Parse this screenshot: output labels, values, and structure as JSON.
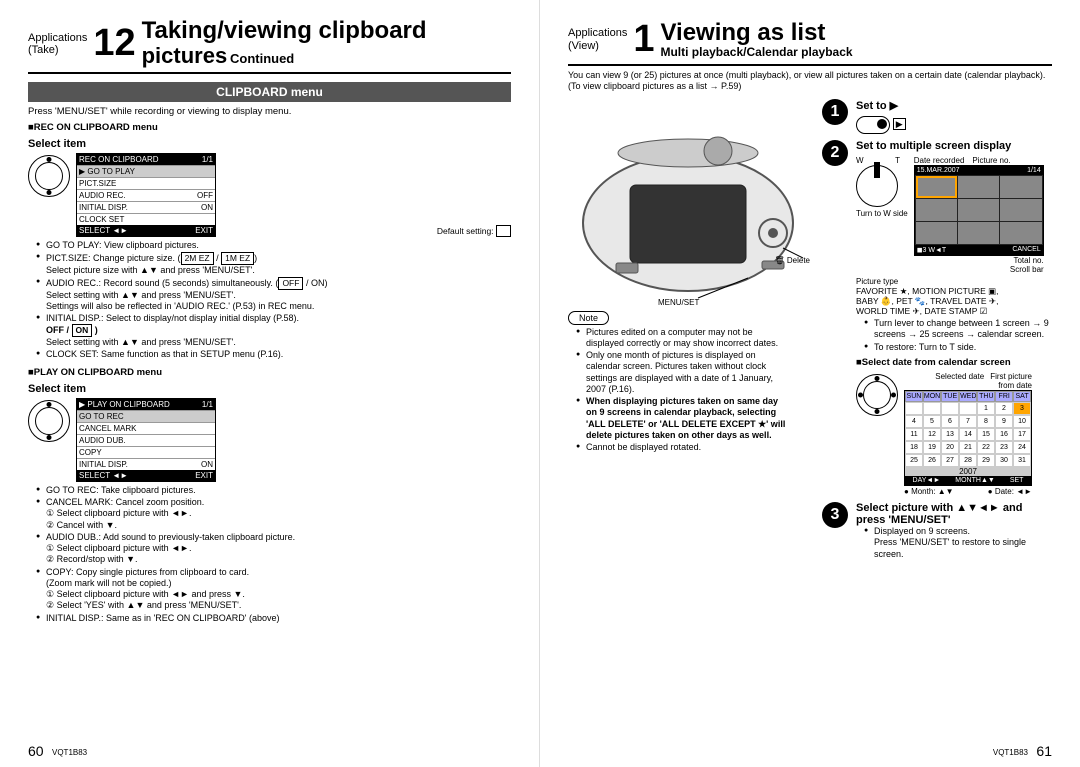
{
  "left": {
    "app_label": "Applications\n(Take)",
    "number": "12",
    "title_main": "Taking/viewing clipboard",
    "title_sub": "pictures",
    "title_cont": "Continued",
    "section_bar": "CLIPBOARD menu",
    "intro": "Press 'MENU/SET' while recording or viewing to display menu.",
    "rec_heading": "■REC ON CLIPBOARD menu",
    "select_item": "Select item",
    "rec_menu": {
      "title": "REC ON CLIPBOARD",
      "rows": [
        {
          "label": "▶ GO TO PLAY",
          "val": ""
        },
        {
          "label": "PICT.SIZE",
          "val": ""
        },
        {
          "label": "AUDIO REC.",
          "val": "OFF"
        },
        {
          "label": "INITIAL DISP.",
          "val": "ON"
        },
        {
          "label": "CLOCK SET",
          "val": ""
        }
      ],
      "foot_l": "SELECT ◄►",
      "foot_r": "EXIT"
    },
    "default_setting": "Default setting:",
    "rec_bullets": [
      "GO TO PLAY: View clipboard pictures.",
      "PICT.SIZE: Change picture size. (<span class='boxed'>2M EZ</span> / <span class='boxed'>1M EZ</span>)<br>Select picture size with ▲▼ and press 'MENU/SET'.",
      "AUDIO REC.: Record sound (5 seconds) simultaneously. (<span class='boxed'>OFF</span> / ON)<br>Select setting with ▲▼ and press 'MENU/SET'.<br>Settings will also be reflected in 'AUDIO REC.' (P.53) in REC menu.",
      "INITIAL DISP.: Select to display/not display initial display (P.58).<br><b>OFF / <span class='boxed'>ON</span> )</b><br>Select setting with ▲▼ and press 'MENU/SET'.",
      "CLOCK SET: Same function as that in SETUP menu (P.16)."
    ],
    "play_heading": "■PLAY ON CLIPBOARD menu",
    "play_menu": {
      "title": "▶ PLAY ON CLIPBOARD",
      "rows": [
        {
          "label": "GO TO REC",
          "val": ""
        },
        {
          "label": "CANCEL MARK",
          "val": ""
        },
        {
          "label": "AUDIO DUB.",
          "val": ""
        },
        {
          "label": "COPY",
          "val": ""
        },
        {
          "label": "INITIAL DISP.",
          "val": "ON"
        }
      ],
      "foot_l": "SELECT ◄►",
      "foot_r": "EXIT"
    },
    "play_bullets": [
      "GO TO REC: Take clipboard pictures.",
      "CANCEL MARK: Cancel zoom position.<br>① Select clipboard picture with ◄►.<br>② Cancel with ▼.",
      "AUDIO DUB.: Add sound to previously-taken clipboard picture.<br>① Select clipboard picture with ◄►.<br>② Record/stop with ▼.",
      "COPY: Copy single pictures from clipboard to card.<br>(Zoom mark will not be copied.)<br>① Select clipboard picture with ◄► and press ▼.<br>② Select 'YES' with ▲▼ and press 'MENU/SET'.",
      "INITIAL DISP.: Same as in 'REC ON CLIPBOARD' (above)"
    ],
    "page_num": "60",
    "code": "VQT1B83"
  },
  "right": {
    "app_label": "Applications\n(View)",
    "number": "1",
    "title_main": "Viewing as list",
    "subtitle": "Multi playback/Calendar playback",
    "intro": "You can view 9 (or 25) pictures at once (multi playback), or view all pictures taken on a certain date (calendar playback). (To view clipboard pictures as a list → P.59)",
    "step1": "Set to ▶",
    "step2": "Set to multiple screen display",
    "annot": {
      "date_rec": "Date recorded",
      "pic_no": "Picture no.",
      "total": "Total no.",
      "scroll": "Scroll bar",
      "turn": "Turn to W side",
      "pic_type": "Picture type",
      "delete": "Delete",
      "menuset": "MENU/SET",
      "w": "W",
      "t": "T",
      "cancel": "CANCEL",
      "date_top": "15.MAR.2007",
      "top_right": "1/14"
    },
    "pictype_lines": [
      "FAVORITE ★, MOTION PICTURE ▣,",
      "BABY 👶, PET 🐾, TRAVEL DATE ✈,",
      "WORLD TIME ✈, DATE STAMP ☑"
    ],
    "lever_bullets": [
      "Turn lever to change between 1 screen → 9 screens → 25 screens → calendar screen.",
      "To restore: Turn to T side."
    ],
    "cal_heading": "■Select date from calendar screen",
    "cal_annot": {
      "first": "First picture",
      "seldate": "Selected date",
      "fromdate": "from date",
      "month": "Month: ▲▼",
      "date": "Date: ◄►"
    },
    "cal": {
      "days": [
        "SUN",
        "MON",
        "TUE",
        "WED",
        "THU",
        "FRI",
        "SAT"
      ],
      "cells": [
        "",
        "",
        "",
        "",
        "1",
        "2",
        "3",
        "4",
        "5",
        "6",
        "7",
        "8",
        "9",
        "10",
        "11",
        "12",
        "13",
        "14",
        "15",
        "16",
        "17",
        "18",
        "19",
        "20",
        "21",
        "22",
        "23",
        "24",
        "25",
        "26",
        "27",
        "28",
        "29",
        "30",
        "31"
      ],
      "year": "2007",
      "sel": "3",
      "foot": [
        "DAY◄►",
        "MONTH▲▼",
        "SET"
      ]
    },
    "step3_a": "Select picture with ▲▼◄► and",
    "step3_b": "press 'MENU/SET'",
    "step3_bullets": [
      "Displayed on 9 screens.<br>Press 'MENU/SET' to restore to single screen."
    ],
    "note_label": "Note",
    "note_bullets": [
      "Pictures edited on a computer may not be displayed correctly or may show incorrect dates.",
      "Only one month of pictures is displayed on calendar screen. Pictures taken without clock settings are displayed with a date of 1 January, 2007 (P.16).",
      "<b>When displaying pictures taken on same day on 9 screens in calendar playback, selecting 'ALL DELETE' or 'ALL DELETE EXCEPT ★' will delete pictures taken on other days as well.</b>",
      "Cannot be displayed rotated."
    ],
    "page_num": "61",
    "code": "VQT1B83"
  }
}
